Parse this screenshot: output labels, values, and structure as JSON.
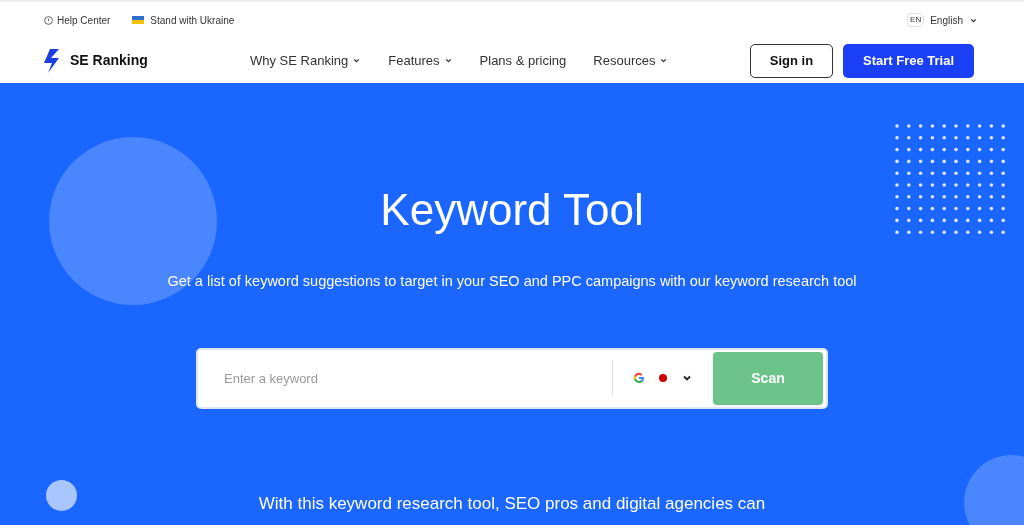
{
  "top_bar": {
    "help": "Help Center",
    "ukraine": "Stand with Ukraine",
    "language_code": "EN",
    "language": "English"
  },
  "header": {
    "logo": "SE Ranking",
    "nav": [
      {
        "label": "Why SE Ranking",
        "dropdown": true
      },
      {
        "label": "Features",
        "dropdown": true
      },
      {
        "label": "Plans & pricing",
        "dropdown": false
      },
      {
        "label": "Resources",
        "dropdown": true
      }
    ],
    "sign_in": "Sign in",
    "trial": "Start Free Trial"
  },
  "hero": {
    "title": "Keyword Tool",
    "subtitle": "Get a list of keyword suggestions to target in your SEO and PPC campaigns with our keyword research tool",
    "search": {
      "placeholder": "Enter a keyword",
      "button": "Scan"
    },
    "footer_text": "With this keyword research tool, SEO pros and digital agencies can"
  }
}
